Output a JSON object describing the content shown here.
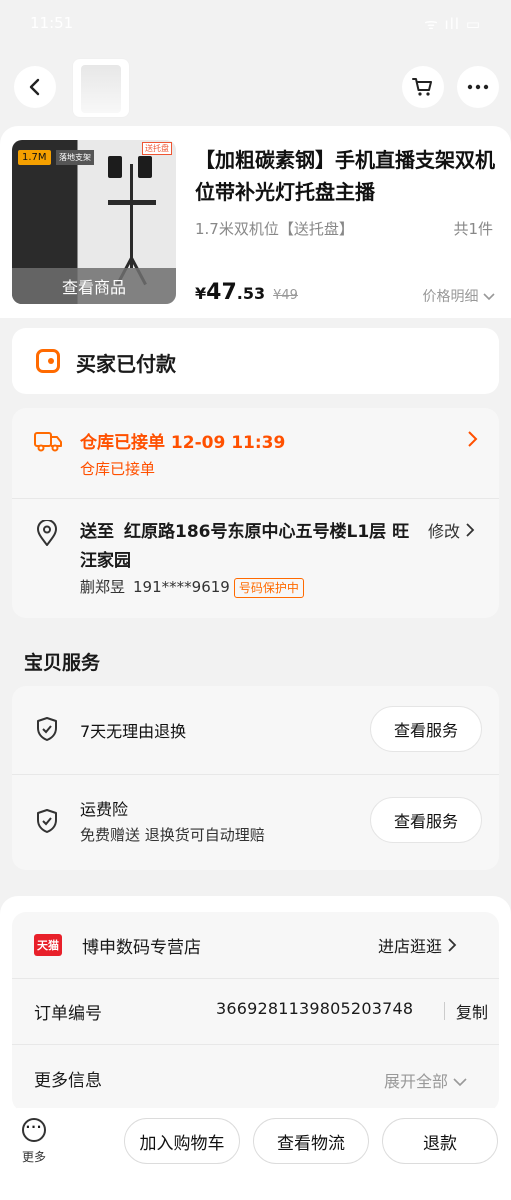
{
  "status_bar": {
    "time": "11:51",
    "signal": "ᯤ ıll ▭"
  },
  "product": {
    "title": "【加粗碳素钢】手机直播支架双机位带补光灯托盘主播",
    "spec": "1.7米双机位【送托盘】",
    "quantity": "共1件",
    "view_label": "查看商品",
    "image_badge": "1.7M",
    "image_badge2": "落地支架",
    "image_tag": "送托盘",
    "price_symbol": "¥",
    "price_int": "47",
    "price_dec": ".53",
    "price_original": "¥49",
    "price_detail_label": "价格明细"
  },
  "order_status": {
    "label": "买家已付款"
  },
  "logistics": {
    "title": "仓库已接单 12-09 11:39",
    "subtitle": "仓库已接单",
    "address_label": "送至",
    "address": "红原路186号东原中心五号楼L1层 旺汪家园",
    "modify_label": "修改",
    "recipient": "蒯郑昱",
    "phone": "191****9619",
    "privacy_badge": "号码保护中"
  },
  "services": {
    "section_title": "宝贝服务",
    "items": [
      {
        "title": "7天无理由退换",
        "button": "查看服务"
      },
      {
        "title": "运费险",
        "subtitle": "免费赠送 退换货可自动理赔",
        "button": "查看服务"
      }
    ]
  },
  "shop": {
    "logo_text": "天猫",
    "name": "博申数码专营店",
    "visit_label": "进店逛逛",
    "order_label": "订单编号",
    "order_number": "3669281139805203748",
    "copy_label": "复制",
    "more_info_label": "更多信息",
    "expand_label": "展开全部"
  },
  "bottom_bar": {
    "more_label": "更多",
    "add_cart": "加入购物车",
    "view_logistics": "查看物流",
    "refund": "退款"
  },
  "colors": {
    "accent": "#ff5000",
    "tmall": "#e8202a"
  }
}
